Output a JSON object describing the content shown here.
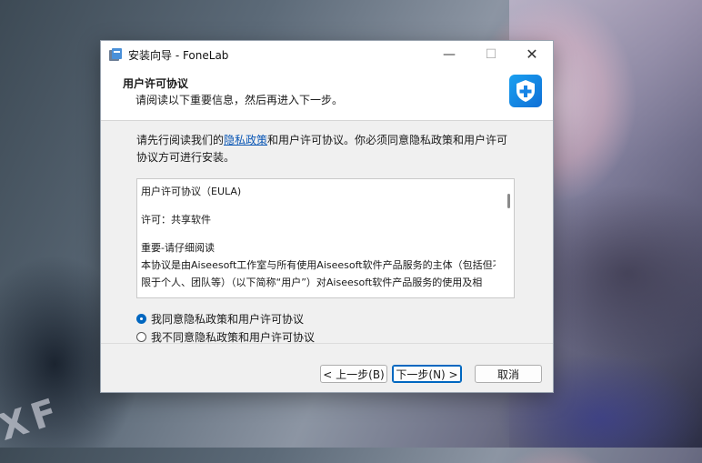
{
  "window": {
    "title": "安装向导 - FoneLab",
    "controls": {
      "minimize": "—",
      "maximize": "☐",
      "close": "✕"
    }
  },
  "header": {
    "title": "用户许可协议",
    "subtitle": "请阅读以下重要信息，然后再进入下一步。",
    "logo_icon": "fonelab-plus-shield-icon"
  },
  "intro": {
    "before_link": "请先行阅读我们的",
    "link": "隐私政策",
    "after_link": "和用户许可协议。你必须同意隐私政策和用户许可协议方可进行安装。"
  },
  "eula": {
    "lines": [
      "用户许可协议（EULA)",
      "许可：共享软件",
      "重要-请仔细阅读",
      "本协议是由Aiseesoft工作室与所有使用Aiseesoft软件产品服务的主体（包括但不",
      "限于个人、团队等）（以下简称“用户”）对Aiseesoft软件产品服务的使用及相"
    ]
  },
  "options": {
    "agree": "我同意隐私政策和用户许可协议",
    "disagree": "我不同意隐私政策和用户许可协议",
    "selected": "agree"
  },
  "buttons": {
    "back": "< 上一步(B)",
    "next": "下一步(N) >",
    "cancel": "取消"
  },
  "background": {
    "text": "XF"
  },
  "colors": {
    "accent": "#0067c0",
    "link": "#0b57b5",
    "logo": "#1aa0f0"
  }
}
